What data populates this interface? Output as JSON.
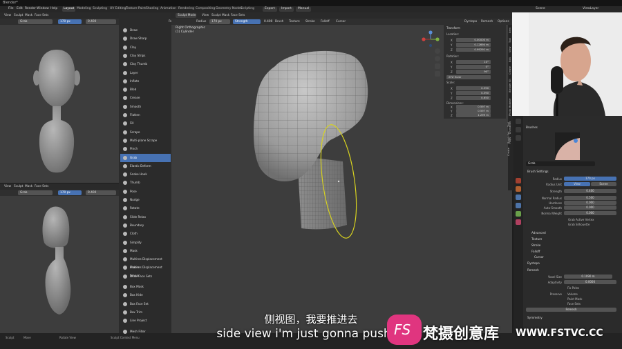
{
  "title_bar": {
    "app_title": "Blender*"
  },
  "menu": {
    "items": [
      "File",
      "Edit",
      "Render",
      "Window",
      "Help"
    ],
    "workspaces": [
      "Layout",
      "Modeling",
      "Sculpting",
      "UV Editing",
      "Texture Paint",
      "Shading",
      "Animation",
      "Rendering",
      "Compositing",
      "Geometry Nodes",
      "Scripting"
    ],
    "active_workspace": "Layout",
    "export": "Export",
    "import": "Import",
    "manual": "Manual",
    "scene": "Scene",
    "view_layer": "ViewLayer"
  },
  "front_view": {
    "header": [
      "View",
      "Sculpt",
      "Mask",
      "Face Sets"
    ],
    "brush": "Grab",
    "radius_label": "Radius",
    "radius": "170 px",
    "strength_label": "Strength",
    "strength": "0.400"
  },
  "side_view": {
    "header": [
      "View",
      "Sculpt",
      "Mask",
      "Face Sets"
    ],
    "brush": "Grab",
    "radius_label": "Radius",
    "radius": "170 px",
    "strength_label": "Strength",
    "strength": "0.400"
  },
  "main_view": {
    "header": [
      "View",
      "Sculpt",
      "Mask",
      "Face Sets"
    ],
    "mode": "Sculpt Mode",
    "brush": "Grab",
    "radius_label": "Radius",
    "radius": "170 px",
    "strength_label": "Strength",
    "strength": "0.400",
    "menus": [
      "Brush",
      "Texture",
      "Stroke",
      "Falloff",
      "Cursor"
    ],
    "dyntopo": "Dyntopo",
    "remesh": "Remesh",
    "options": "Options",
    "viewport_label": "Right Orthographic",
    "object_label": "(1) Cylinder"
  },
  "brushes": [
    "Draw",
    "Draw Sharp",
    "Clay",
    "Clay Strips",
    "Clay Thumb",
    "Layer",
    "Inflate",
    "Blob",
    "Crease",
    "Smooth",
    "Flatten",
    "Fill",
    "Scrape",
    "Multi-plane Scrape",
    "Pinch",
    "Grab",
    "Elastic Deform",
    "Snake Hook",
    "Thumb",
    "Pose",
    "Nudge",
    "Rotate",
    "Slide Relax",
    "Boundary",
    "Cloth",
    "Simplify",
    "Mask",
    "Multires Displacement Eraser",
    "Multires Displacement Smear",
    "Draw Face Sets",
    "Box Mask",
    "Box Hide",
    "Box Face Set",
    "Box Trim",
    "Line Project",
    "Mesh Filter"
  ],
  "selected_brush": "Grab",
  "n_panel": {
    "transform": "Transform",
    "location": "Location:",
    "loc": [
      [
        "X",
        "0.00000 m"
      ],
      [
        "Y",
        "0.12694 m"
      ],
      [
        "Z",
        "0.99291 m"
      ]
    ],
    "rotation": "Rotation:",
    "rot": [
      [
        "X",
        "10°"
      ],
      [
        "Y",
        "0°"
      ],
      [
        "Z",
        "90°"
      ]
    ],
    "rot_mode": "XYZ Euler",
    "scale": "Scale:",
    "scl": [
      [
        "X",
        "0.390"
      ],
      [
        "Y",
        "0.390"
      ],
      [
        "Z",
        "0.650"
      ]
    ],
    "dimensions": "Dimensions:",
    "dim": [
      [
        "X",
        "0.597 m"
      ],
      [
        "Y",
        "0.597 m"
      ],
      [
        "Z",
        "1.299 m"
      ]
    ],
    "tabs": [
      "Item",
      "Tool",
      "View",
      "Edit",
      "Create",
      "Blender Kit",
      "Photo Modeler",
      "Animation",
      "Hops"
    ]
  },
  "properties": {
    "brushes_head": "Brushes",
    "brush_name": "Grab",
    "brush_settings": "Brush Settings",
    "rows": [
      {
        "label": "Radius",
        "value": "170 px"
      },
      {
        "label": "Radius Unit",
        "value": "View",
        "value2": "Scene"
      },
      {
        "label": "Strength",
        "value": "0.400"
      },
      {
        "label": "Normal Radius",
        "value": "0.500"
      },
      {
        "label": "Hardness",
        "value": "0.000"
      },
      {
        "label": "Auto-Smooth",
        "value": "0.000"
      },
      {
        "label": "Normal Weight",
        "value": "0.000"
      }
    ],
    "checks": [
      "Grab Active Vertex",
      "Grab Silhouette"
    ],
    "subsections": [
      "Advanced",
      "Texture",
      "Stroke",
      "Falloff",
      "Cursor"
    ],
    "dyntopo": "Dyntopo",
    "remesh": "Remesh",
    "voxel_size_label": "Voxel Size",
    "voxel_size": "0.1090 m",
    "adaptivity_label": "Adaptivity",
    "adaptivity": "0.0000",
    "fix_poles": "Fix Poles",
    "preserve_label": "Preserve",
    "preserve": [
      "Volume",
      "Paint Mask",
      "Face Sets"
    ],
    "remesh_button": "Remesh",
    "symmetry": "Symmetry",
    "side_tabs": [
      "Tool",
      "Brush Set",
      "Create"
    ]
  },
  "status_bar": {
    "items": [
      "Sculpt",
      "Move",
      "Rotate View",
      "Sculpt Context Menu"
    ]
  },
  "subtitles": {
    "chinese": "侧视图，我要推进去",
    "english": "side view i'm just gonna push in"
  },
  "watermark": {
    "logo": "FS",
    "chinese": "梵摄创意库",
    "url": "WWW.FSTVC.CC"
  },
  "colors": {
    "accent": "#4772b3",
    "viewport": "#3d3d3d",
    "sculpt_ring": "#d8d320",
    "watermark_pink": "#e0357f"
  }
}
